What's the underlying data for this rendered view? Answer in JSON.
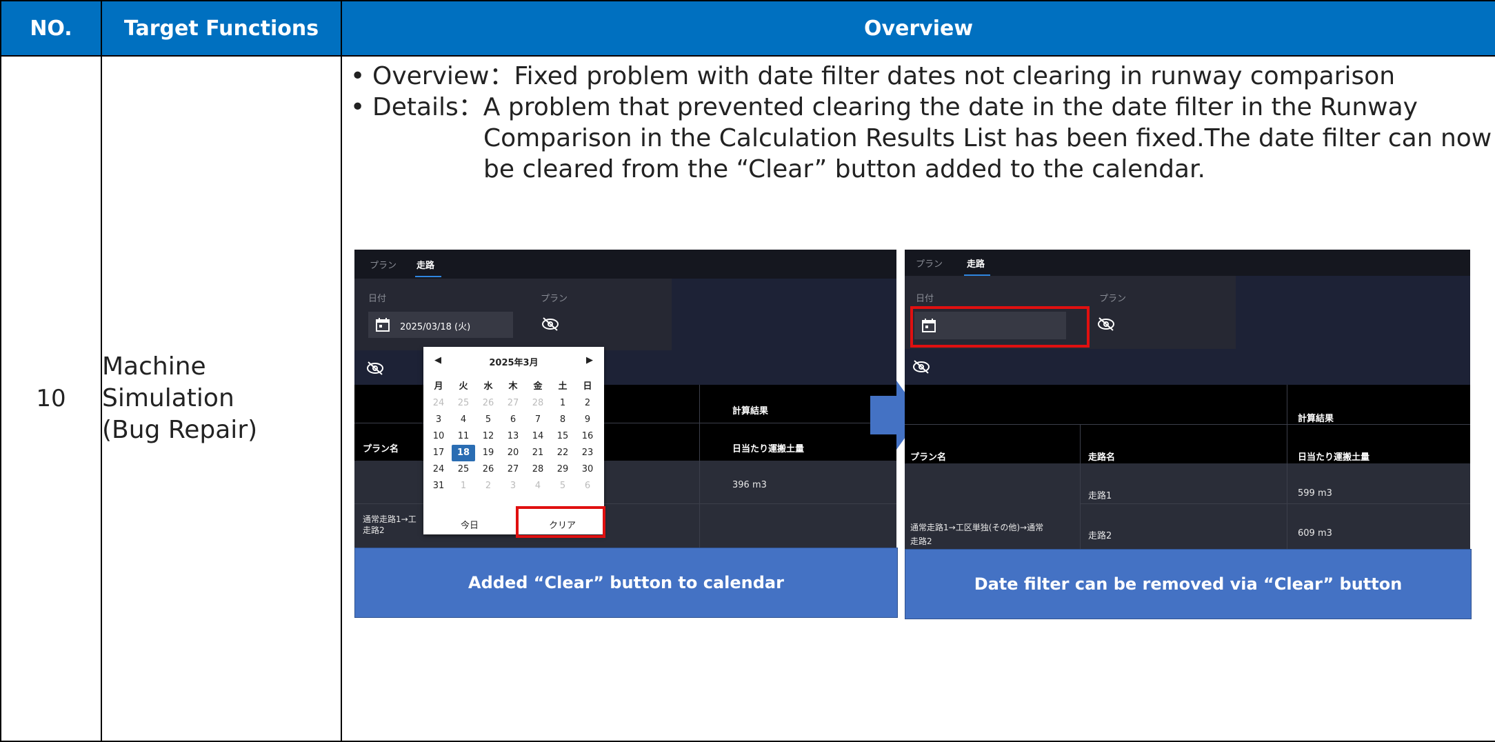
{
  "table": {
    "headers": {
      "no": "NO.",
      "target": "Target Functions",
      "overview": "Overview"
    },
    "row": {
      "no": "10",
      "target_lines": [
        "Machine",
        "Simulation",
        "(Bug Repair)"
      ],
      "overview_line": "Overview：Fixed problem with date filter dates not clearing in runway comparison",
      "details_line1": "Details：A problem that prevented clearing the date in the date filter in the Runway",
      "details_line2": "Comparison in the Calculation Results List has been fixed.The date filter can now",
      "details_line3": "be cleared from the “Clear” button added to the calendar."
    }
  },
  "before": {
    "tabs": [
      "プラン",
      "走路"
    ],
    "date_label": "日付",
    "plan_label": "プラン",
    "date_value": "2025/03/18 (火)",
    "calc_result_header": "計算結果",
    "plan_name_header": "プラン名",
    "daily_volume_header": "日当たり運搬土量",
    "row_value": "396 m3",
    "plan_cell_line1": "通常走路1→工",
    "plan_cell_line2": "走路2",
    "caption": "Added “Clear” button to calendar",
    "calendar": {
      "month": "2025年3月",
      "prev": "◀",
      "next": "▶",
      "weekdays": [
        "月",
        "火",
        "水",
        "木",
        "金",
        "土",
        "日"
      ],
      "weeks": [
        [
          "24",
          "25",
          "26",
          "27",
          "28",
          "1",
          "2"
        ],
        [
          "3",
          "4",
          "5",
          "6",
          "7",
          "8",
          "9"
        ],
        [
          "10",
          "11",
          "12",
          "13",
          "14",
          "15",
          "16"
        ],
        [
          "17",
          "18",
          "19",
          "20",
          "21",
          "22",
          "23"
        ],
        [
          "24",
          "25",
          "26",
          "27",
          "28",
          "29",
          "30"
        ],
        [
          "31",
          "1",
          "2",
          "3",
          "4",
          "5",
          "6"
        ]
      ],
      "today": "今日",
      "clear": "クリア"
    }
  },
  "after": {
    "tabs": [
      "プラン",
      "走路"
    ],
    "date_label": "日付",
    "plan_label": "プラン",
    "calc_result_header": "計算結果",
    "plan_name_header": "プラン名",
    "route_name_header": "走路名",
    "daily_volume_header": "日当たり運搬土量",
    "rows": [
      {
        "route": "走路1",
        "value": "599 m3"
      },
      {
        "route": "走路2",
        "value": "609 m3"
      }
    ],
    "plan_cell_line1": "通常走路1→工区単独(その他)→通常",
    "plan_cell_line2": "走路2",
    "caption": "Date filter can be removed via “Clear” button"
  },
  "colors": {
    "header_blue": "#0070c0",
    "caption_blue": "#4472c4",
    "highlight_red": "#e01010",
    "selected_day": "#2a6db3"
  }
}
